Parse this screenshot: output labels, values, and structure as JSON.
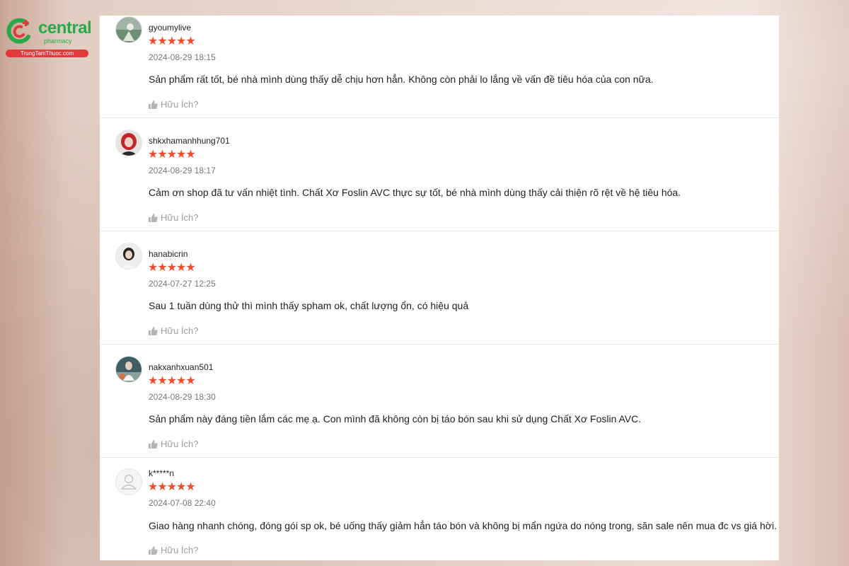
{
  "brand": {
    "name": "central",
    "sub": "pharmacy",
    "site": "TrungTamThuoc.com",
    "colors": {
      "green": "#2aa84a",
      "red": "#e23a3a",
      "star": "#ee4d2d"
    }
  },
  "helpful_label": "Hữu Ích?",
  "reviews": [
    {
      "username": "gyoumylive",
      "rating": 5,
      "time": "2024-08-29 18:15",
      "comment": "Sản phẩm rất tốt, bé nhà mình dùng thấy dễ chịu hơn hẳn. Không còn phải lo lắng về vấn đề tiêu hóa của con nữa.",
      "avatar": "photo-avatar"
    },
    {
      "username": "shkxhamanhhung701",
      "rating": 5,
      "time": "2024-08-29 18:17",
      "comment": "Cảm ơn shop đã tư vấn nhiệt tình. Chất Xơ Foslin AVC thực sự tốt, bé nhà mình dùng thấy cải thiện rõ rệt về hệ tiêu hóa.",
      "avatar": "photo-avatar"
    },
    {
      "username": "hanabicrin",
      "rating": 5,
      "time": "2024-07-27 12:25",
      "comment": "Sau 1 tuần dùng thử thì mình thấy spham ok, chất lượng ổn, có hiệu quả",
      "avatar": "photo-avatar"
    },
    {
      "username": "nakxanhxuan501",
      "rating": 5,
      "time": "2024-08-29 18:30",
      "comment": "Sản phẩm này đáng tiền lắm các mẹ ạ. Con mình đã không còn bị táo bón sau khi sử dụng Chất Xơ Foslin AVC.",
      "avatar": "photo-avatar"
    },
    {
      "username": "k*****n",
      "rating": 5,
      "time": "2024-07-08 22:40",
      "comment": "Giao hàng nhanh chóng, đóng gói sp ok, bé uống thấy giảm hẳn táo bón và không bị mẩn ngứa do nóng trong, săn sale nên mua đc vs giá hời.",
      "avatar": "default-user-icon"
    }
  ]
}
